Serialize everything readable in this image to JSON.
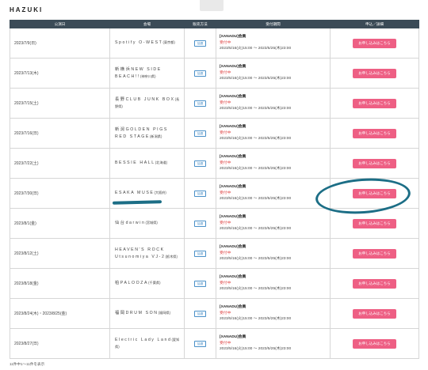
{
  "artist": "HAZUKI",
  "headers": {
    "date": "公演日",
    "venue": "会場",
    "method": "販売方法",
    "period": "受付期間",
    "apply": "申込／詳細"
  },
  "rows": [
    {
      "date": "2023/7/9(日)",
      "venue_name": "Spotify O-WEST",
      "venue_area": "(東京都)",
      "method": "抽選",
      "period_name": "[XANADU]会員",
      "period_status": "受付中",
      "period_range": "2023/5/16(火)15:00 ～ 2023/5/25(木)23:00",
      "apply_label": "お申し込みはこちら"
    },
    {
      "date": "2023/7/13(木)",
      "venue_name": "新横浜NEW SIDE BEACH!!",
      "venue_area": "(神奈川県)",
      "method": "抽選",
      "period_name": "[XANADU]会員",
      "period_status": "受付中",
      "period_range": "2023/5/16(火)15:00 ～ 2023/5/25(木)23:00",
      "apply_label": "お申し込みはこちら"
    },
    {
      "date": "2023/7/15(土)",
      "venue_name": "長野CLUB JUNK BOX",
      "venue_area": "(長野県)",
      "method": "抽選",
      "period_name": "[XANADU]会員",
      "period_status": "受付中",
      "period_range": "2023/5/16(火)15:00 ～ 2023/5/25(木)23:00",
      "apply_label": "お申し込みはこちら"
    },
    {
      "date": "2023/7/16(日)",
      "venue_name": "新潟GOLDEN PIGS RED STAGE",
      "venue_area": "(新潟県)",
      "method": "抽選",
      "period_name": "[XANADU]会員",
      "period_status": "受付中",
      "period_range": "2023/5/16(火)15:00 ～ 2023/5/25(木)23:00",
      "apply_label": "お申し込みはこちら"
    },
    {
      "date": "2023/7/22(土)",
      "venue_name": "BESSIE HALL",
      "venue_area": "(北海道)",
      "method": "抽選",
      "period_name": "[XANADU]会員",
      "period_status": "受付中",
      "period_range": "2023/5/16(火)15:00 ～ 2023/5/25(木)23:00",
      "apply_label": "お申し込みはこちら"
    },
    {
      "date": "2023/7/30(日)",
      "venue_name": "ESAKA MUSE",
      "venue_area": "(大阪府)",
      "method": "抽選",
      "period_name": "[XANADU]会員",
      "period_status": "受付中",
      "period_range": "2023/5/16(火)15:00 ～ 2023/5/25(木)23:00",
      "apply_label": "お申し込みはこちら"
    },
    {
      "date": "2023/8/1(金)",
      "venue_name": "仙台darwin",
      "venue_area": "(宮城県)",
      "method": "抽選",
      "period_name": "[XANADU]会員",
      "period_status": "受付中",
      "period_range": "2023/5/16(火)15:00 ～ 2023/5/25(木)23:00",
      "apply_label": "お申し込みはこちら"
    },
    {
      "date": "2023/8/12(土)",
      "venue_name": "HEAVEN'S ROCK Utsunomiya VJ-2",
      "venue_area": "(栃木県)",
      "method": "抽選",
      "period_name": "[XANADU]会員",
      "period_status": "受付中",
      "period_range": "2023/5/16(火)15:00 ～ 2023/5/25(木)23:00",
      "apply_label": "お申し込みはこちら"
    },
    {
      "date": "2023/8/18(金)",
      "venue_name": "柏PALOOZA",
      "venue_area": "(千葉県)",
      "method": "抽選",
      "period_name": "[XANADU]会員",
      "period_status": "受付中",
      "period_range": "2023/5/16(火)15:00 ～ 2023/5/25(木)23:00",
      "apply_label": "お申し込みはこちら"
    },
    {
      "date": "2023/8/24(木)・2023/8/25(金)",
      "venue_name": "福岡DRUM SON",
      "venue_area": "(福岡県)",
      "method": "抽選",
      "period_name": "[XANADU]会員",
      "period_status": "受付中",
      "period_range": "2023/5/16(火)15:00 ～ 2023/5/25(木)23:00",
      "apply_label": "お申し込みはこちら"
    },
    {
      "date": "2023/8/27(日)",
      "venue_name": "Electric Lady Land",
      "venue_area": "(愛知県)",
      "method": "抽選",
      "period_name": "[XANADU]会員",
      "period_status": "受付中",
      "period_range": "2023/5/16(火)15:00 ～ 2023/5/25(木)23:00",
      "apply_label": "お申し込みはこちら"
    }
  ],
  "footer_count": "11件中1～11件を表示",
  "colors": {
    "header_bg": "#3b4b57",
    "apply_button": "#ee5f84",
    "status_text": "#e04848",
    "badge": "#4a90c8",
    "annotation": "#1c6e86"
  }
}
